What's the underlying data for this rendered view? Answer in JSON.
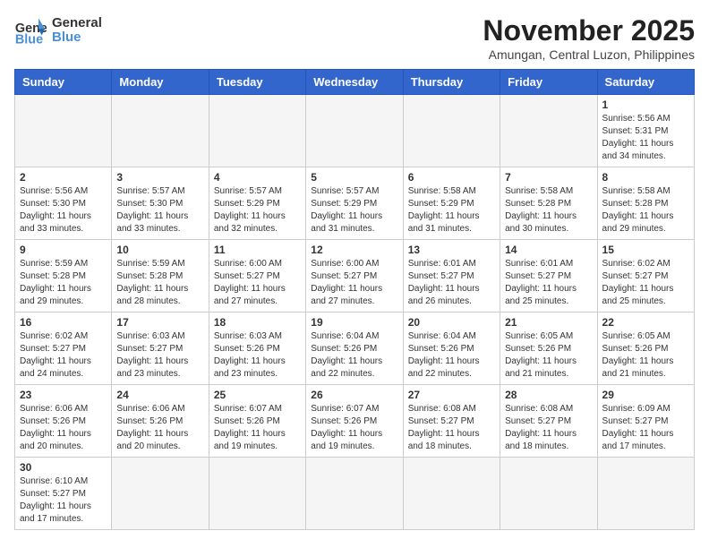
{
  "header": {
    "logo_general": "General",
    "logo_blue": "Blue",
    "month": "November 2025",
    "location": "Amungan, Central Luzon, Philippines"
  },
  "weekdays": [
    "Sunday",
    "Monday",
    "Tuesday",
    "Wednesday",
    "Thursday",
    "Friday",
    "Saturday"
  ],
  "weeks": [
    [
      {
        "day": "",
        "info": ""
      },
      {
        "day": "",
        "info": ""
      },
      {
        "day": "",
        "info": ""
      },
      {
        "day": "",
        "info": ""
      },
      {
        "day": "",
        "info": ""
      },
      {
        "day": "",
        "info": ""
      },
      {
        "day": "1",
        "info": "Sunrise: 5:56 AM\nSunset: 5:31 PM\nDaylight: 11 hours and 34 minutes."
      }
    ],
    [
      {
        "day": "2",
        "info": "Sunrise: 5:56 AM\nSunset: 5:30 PM\nDaylight: 11 hours and 33 minutes."
      },
      {
        "day": "3",
        "info": "Sunrise: 5:57 AM\nSunset: 5:30 PM\nDaylight: 11 hours and 33 minutes."
      },
      {
        "day": "4",
        "info": "Sunrise: 5:57 AM\nSunset: 5:29 PM\nDaylight: 11 hours and 32 minutes."
      },
      {
        "day": "5",
        "info": "Sunrise: 5:57 AM\nSunset: 5:29 PM\nDaylight: 11 hours and 31 minutes."
      },
      {
        "day": "6",
        "info": "Sunrise: 5:58 AM\nSunset: 5:29 PM\nDaylight: 11 hours and 31 minutes."
      },
      {
        "day": "7",
        "info": "Sunrise: 5:58 AM\nSunset: 5:28 PM\nDaylight: 11 hours and 30 minutes."
      },
      {
        "day": "8",
        "info": "Sunrise: 5:58 AM\nSunset: 5:28 PM\nDaylight: 11 hours and 29 minutes."
      }
    ],
    [
      {
        "day": "9",
        "info": "Sunrise: 5:59 AM\nSunset: 5:28 PM\nDaylight: 11 hours and 29 minutes."
      },
      {
        "day": "10",
        "info": "Sunrise: 5:59 AM\nSunset: 5:28 PM\nDaylight: 11 hours and 28 minutes."
      },
      {
        "day": "11",
        "info": "Sunrise: 6:00 AM\nSunset: 5:27 PM\nDaylight: 11 hours and 27 minutes."
      },
      {
        "day": "12",
        "info": "Sunrise: 6:00 AM\nSunset: 5:27 PM\nDaylight: 11 hours and 27 minutes."
      },
      {
        "day": "13",
        "info": "Sunrise: 6:01 AM\nSunset: 5:27 PM\nDaylight: 11 hours and 26 minutes."
      },
      {
        "day": "14",
        "info": "Sunrise: 6:01 AM\nSunset: 5:27 PM\nDaylight: 11 hours and 25 minutes."
      },
      {
        "day": "15",
        "info": "Sunrise: 6:02 AM\nSunset: 5:27 PM\nDaylight: 11 hours and 25 minutes."
      }
    ],
    [
      {
        "day": "16",
        "info": "Sunrise: 6:02 AM\nSunset: 5:27 PM\nDaylight: 11 hours and 24 minutes."
      },
      {
        "day": "17",
        "info": "Sunrise: 6:03 AM\nSunset: 5:27 PM\nDaylight: 11 hours and 23 minutes."
      },
      {
        "day": "18",
        "info": "Sunrise: 6:03 AM\nSunset: 5:26 PM\nDaylight: 11 hours and 23 minutes."
      },
      {
        "day": "19",
        "info": "Sunrise: 6:04 AM\nSunset: 5:26 PM\nDaylight: 11 hours and 22 minutes."
      },
      {
        "day": "20",
        "info": "Sunrise: 6:04 AM\nSunset: 5:26 PM\nDaylight: 11 hours and 22 minutes."
      },
      {
        "day": "21",
        "info": "Sunrise: 6:05 AM\nSunset: 5:26 PM\nDaylight: 11 hours and 21 minutes."
      },
      {
        "day": "22",
        "info": "Sunrise: 6:05 AM\nSunset: 5:26 PM\nDaylight: 11 hours and 21 minutes."
      }
    ],
    [
      {
        "day": "23",
        "info": "Sunrise: 6:06 AM\nSunset: 5:26 PM\nDaylight: 11 hours and 20 minutes."
      },
      {
        "day": "24",
        "info": "Sunrise: 6:06 AM\nSunset: 5:26 PM\nDaylight: 11 hours and 20 minutes."
      },
      {
        "day": "25",
        "info": "Sunrise: 6:07 AM\nSunset: 5:26 PM\nDaylight: 11 hours and 19 minutes."
      },
      {
        "day": "26",
        "info": "Sunrise: 6:07 AM\nSunset: 5:26 PM\nDaylight: 11 hours and 19 minutes."
      },
      {
        "day": "27",
        "info": "Sunrise: 6:08 AM\nSunset: 5:27 PM\nDaylight: 11 hours and 18 minutes."
      },
      {
        "day": "28",
        "info": "Sunrise: 6:08 AM\nSunset: 5:27 PM\nDaylight: 11 hours and 18 minutes."
      },
      {
        "day": "29",
        "info": "Sunrise: 6:09 AM\nSunset: 5:27 PM\nDaylight: 11 hours and 17 minutes."
      }
    ],
    [
      {
        "day": "30",
        "info": "Sunrise: 6:10 AM\nSunset: 5:27 PM\nDaylight: 11 hours and 17 minutes."
      },
      {
        "day": "",
        "info": ""
      },
      {
        "day": "",
        "info": ""
      },
      {
        "day": "",
        "info": ""
      },
      {
        "day": "",
        "info": ""
      },
      {
        "day": "",
        "info": ""
      },
      {
        "day": "",
        "info": ""
      }
    ]
  ]
}
